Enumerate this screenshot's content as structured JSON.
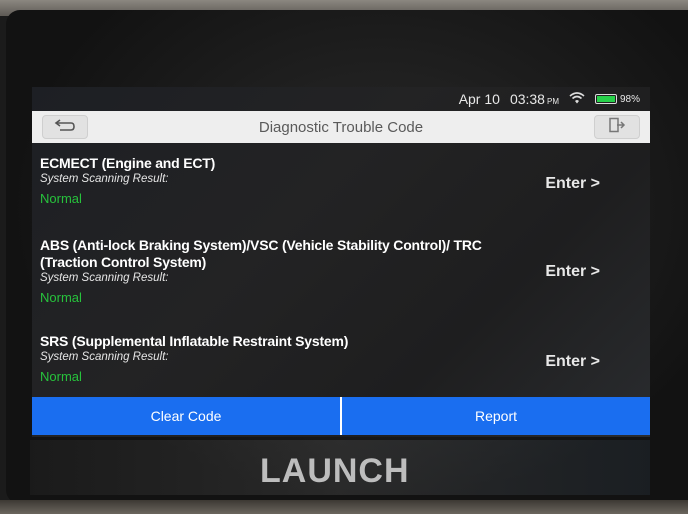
{
  "status": {
    "date": "Apr 10",
    "time": "03:38",
    "ampm": "PM",
    "battery": "98%",
    "battery_level": 0.98,
    "battery_color": "#27d14a"
  },
  "header": {
    "title": "Diagnostic Trouble Code",
    "back_icon": "back-arrow-icon",
    "exit_icon": "exit-icon"
  },
  "systems": [
    {
      "name": "ECMECT (Engine and ECT)",
      "result_label": "System Scanning Result:",
      "result": "Normal",
      "action": "Enter >"
    },
    {
      "name": "ABS (Anti-lock Braking System)/VSC (Vehicle Stability Control)/ TRC (Traction Control System)",
      "result_label": "System Scanning Result:",
      "result": "Normal",
      "action": "Enter >"
    },
    {
      "name": "SRS (Supplemental Inflatable Restraint System)",
      "result_label": "System Scanning Result:",
      "result": "Normal",
      "action": "Enter >"
    }
  ],
  "footer": {
    "clear_code": "Clear Code",
    "report": "Report",
    "button_color": "#1a6ef0"
  },
  "brand": "LAUNCH"
}
